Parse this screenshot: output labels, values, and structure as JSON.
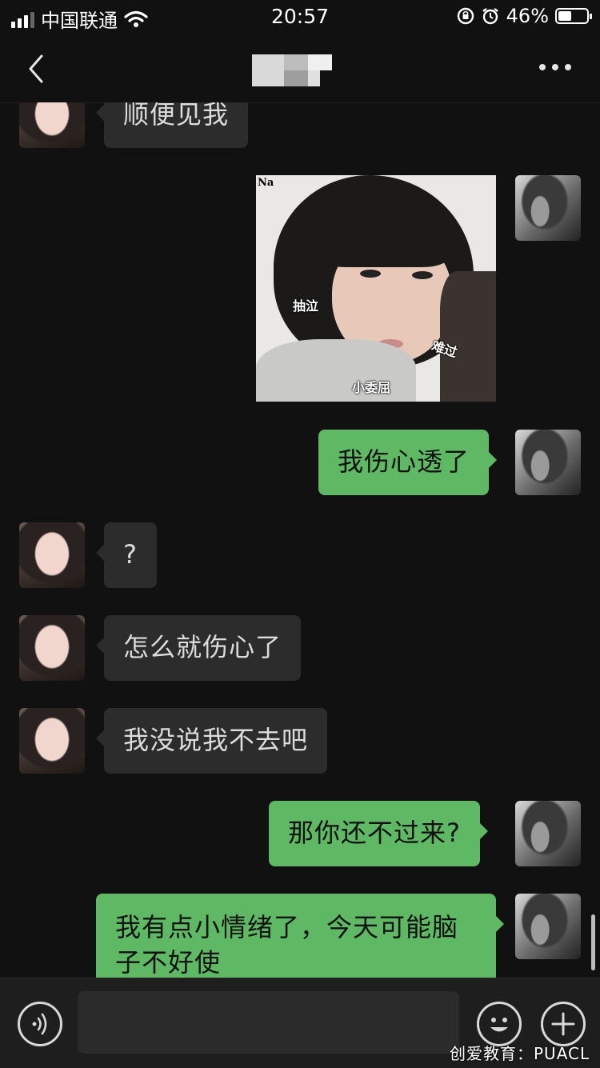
{
  "status_bar": {
    "carrier": "中国联通",
    "time": "20:57",
    "battery": "46%",
    "battery_level": 0.46
  },
  "nav": {
    "back_icon": "chevron-left-icon",
    "title": "",
    "more_icon": "more-horizontal-icon"
  },
  "messages": [
    {
      "from": "other",
      "type": "text",
      "text": "顺便见我"
    },
    {
      "from": "me",
      "type": "image",
      "sticker_labels": [
        "Na",
        "抽泣",
        "难过",
        "小委屈"
      ]
    },
    {
      "from": "me",
      "type": "text",
      "text": "我伤心透了"
    },
    {
      "from": "other",
      "type": "text",
      "text": "?"
    },
    {
      "from": "other",
      "type": "text",
      "text": "怎么就伤心了"
    },
    {
      "from": "other",
      "type": "text",
      "text": "我没说我不去吧"
    },
    {
      "from": "me",
      "type": "text",
      "text": "那你还不过来?"
    },
    {
      "from": "me",
      "type": "text",
      "text": "我有点小情绪了，今天可能脑子不好使"
    }
  ],
  "input_bar": {
    "voice_icon": "voice-icon",
    "input_value": "",
    "emoji_icon": "emoji-icon",
    "plus_icon": "plus-icon"
  },
  "watermark": "创爱教育：PUACL",
  "colors": {
    "background": "#111111",
    "incoming_bubble": "#2c2c2c",
    "outgoing_bubble": "#5fb863"
  }
}
